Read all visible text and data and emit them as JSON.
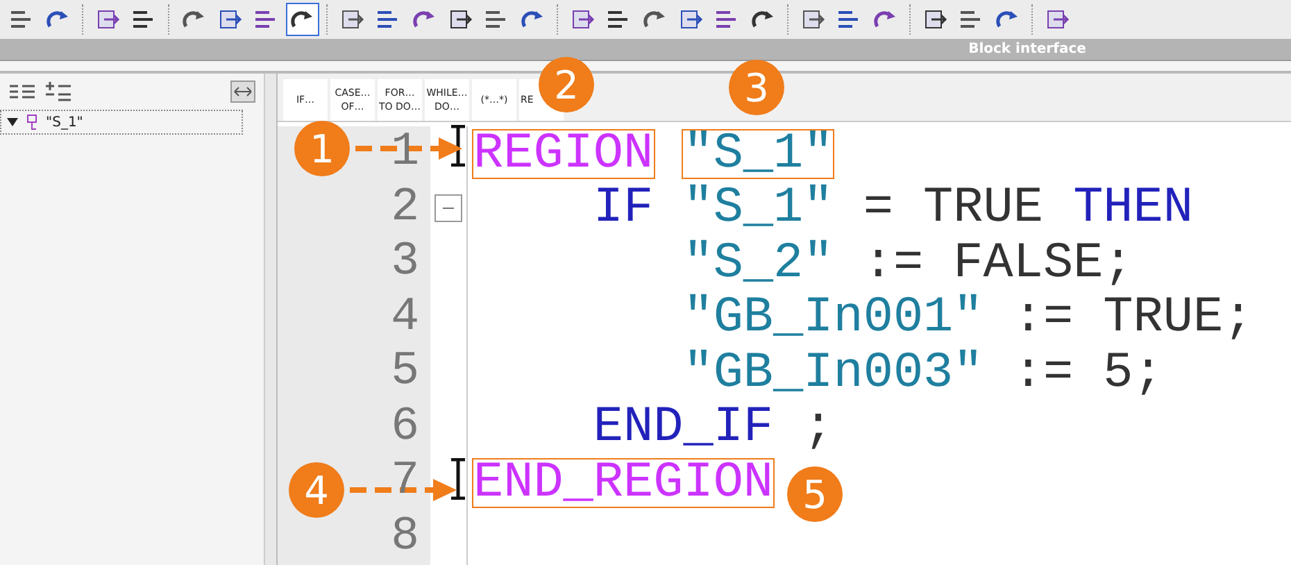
{
  "interface_bar": {
    "title": "Block interface"
  },
  "tree": {
    "items": [
      {
        "label": "\"S_1\"",
        "expanded": true,
        "selected": true
      }
    ]
  },
  "snippets": [
    {
      "label": "IF…"
    },
    {
      "label": "CASE…\nOF…"
    },
    {
      "label": "FOR…\nTO DO…"
    },
    {
      "label": "WHILE…\nDO…"
    },
    {
      "label": "(*…*)"
    },
    {
      "label": "RE"
    }
  ],
  "lines": [
    {
      "number": "1",
      "tokens": [
        {
          "kind": "region",
          "text": "REGION",
          "highlighted": true
        },
        {
          "kind": "tag",
          "text": "\"S_1\"",
          "highlighted": true
        }
      ],
      "children": [
        {
          "number": "2",
          "expanded": true,
          "tokens": [
            {
              "kind": "keyword",
              "text": "IF"
            },
            {
              "kind": "tag",
              "text": "\"S_1\""
            },
            {
              "kind": "operator",
              "text": "="
            },
            {
              "kind": "constant",
              "text": "TRUE"
            },
            {
              "kind": "keyword",
              "text": "THEN"
            }
          ],
          "children": [
            {
              "number": "3",
              "tokens": [
                {
                  "kind": "tag",
                  "text": "\"S_2\""
                },
                {
                  "kind": "operator",
                  "text": ":="
                },
                {
                  "kind": "constant",
                  "text": "FALSE;"
                }
              ]
            },
            {
              "number": "4",
              "tokens": [
                {
                  "kind": "tag",
                  "text": "\"GB_In001\""
                },
                {
                  "kind": "operator",
                  "text": ":="
                },
                {
                  "kind": "constant",
                  "text": "TRUE;"
                }
              ]
            },
            {
              "number": "5",
              "tokens": [
                {
                  "kind": "tag",
                  "text": "\"GB_In003\""
                },
                {
                  "kind": "operator",
                  "text": ":="
                },
                {
                  "kind": "constant",
                  "text": "5;"
                }
              ]
            }
          ]
        },
        {
          "number": "6",
          "tokens": [
            {
              "kind": "keyword",
              "text": "END_IF"
            },
            {
              "kind": "operator",
              "text": ";"
            }
          ]
        }
      ]
    },
    {
      "number": "7",
      "tokens": [
        {
          "kind": "region",
          "text": "END_REGION",
          "highlighted": true
        }
      ]
    },
    {
      "number": "8"
    }
  ],
  "callouts": [
    {
      "label": "1",
      "kind": "arrow"
    },
    {
      "label": "2",
      "kind": "plain"
    },
    {
      "label": "3",
      "kind": "plain"
    },
    {
      "label": "4",
      "kind": "arrow"
    },
    {
      "label": "5",
      "kind": "plain"
    }
  ]
}
